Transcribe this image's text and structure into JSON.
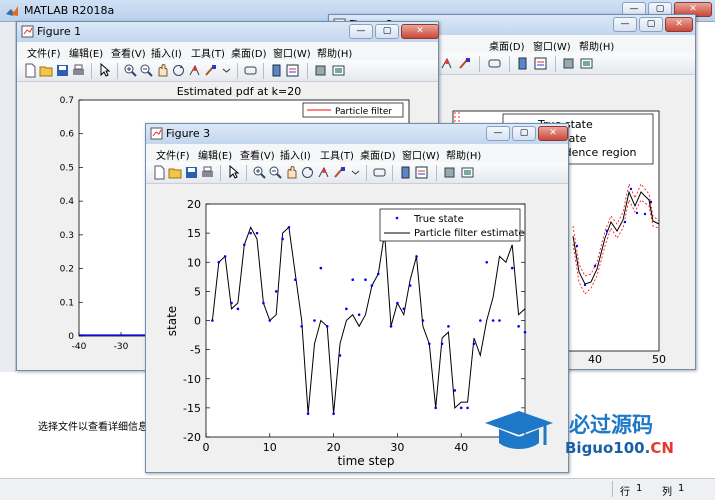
{
  "main_window": {
    "title": "MATLAB R2018a",
    "status_text": "选择文件以查看详细信息",
    "statusbar": {
      "row_label": "行",
      "row_value": "1",
      "col_label": "列",
      "col_value": "1"
    }
  },
  "menus": {
    "file": "文件(F)",
    "edit": "编辑(E)",
    "view": "查看(V)",
    "insert": "插入(I)",
    "tools": "工具(T)",
    "desktop": "桌面(D)",
    "window": "窗口(W)",
    "help": "帮助(H)"
  },
  "window_buttons": {
    "minimize": "—",
    "maximize": "▢",
    "close": "✕"
  },
  "figure1": {
    "title": "Figure 1",
    "chart_data": {
      "type": "line",
      "title": "Estimated pdf at k=20",
      "legend": [
        "Particle filter"
      ],
      "legend_placement": "top-right",
      "xlim": [
        -40,
        0
      ],
      "ylim": [
        0,
        0.7
      ],
      "x_ticks": [
        "-40",
        "-30"
      ],
      "y_ticks": [
        "0",
        "0.1",
        "0.2",
        "0.3",
        "0.4",
        "0.5",
        "0.6",
        "0.7"
      ],
      "series": [
        {
          "name": "Particle filter",
          "color": "#ff0000"
        }
      ],
      "baseline_color": "#0000ff"
    }
  },
  "figure2": {
    "title": "Figure 2",
    "chart_data": {
      "type": "line",
      "legend": [
        "True state",
        "estimate",
        "confidence region"
      ],
      "legend_placement": "top-right",
      "x_ticks": [
        "40",
        "50"
      ],
      "series": [
        {
          "name": "True state",
          "color": "#0000ff"
        },
        {
          "name": "estimate",
          "color": "#000000"
        },
        {
          "name": "confidence region",
          "color": "#ff0000"
        }
      ]
    }
  },
  "figure3": {
    "title": "Figure 3",
    "chart_data": {
      "type": "line",
      "xlabel": "time step",
      "ylabel": "state",
      "xlim": [
        0,
        50
      ],
      "ylim": [
        -20,
        20
      ],
      "x_ticks": [
        "0",
        "10",
        "20",
        "30",
        "40"
      ],
      "y_ticks": [
        "20",
        "15",
        "10",
        "5",
        "0",
        "-5",
        "-10",
        "-15",
        "-20"
      ],
      "legend_placement": "top-right",
      "series": [
        {
          "name": "True state",
          "style": "points",
          "color": "#0000ff",
          "x": [
            1,
            2,
            3,
            4,
            5,
            6,
            7,
            8,
            9,
            10,
            11,
            12,
            13,
            14,
            15,
            16,
            17,
            18,
            19,
            20,
            21,
            22,
            23,
            24,
            25,
            26,
            27,
            28,
            29,
            30,
            31,
            32,
            33,
            34,
            35,
            36,
            37,
            38,
            39,
            40,
            41,
            42,
            43,
            44,
            45,
            46,
            47,
            48,
            49,
            50
          ],
          "y": [
            0,
            10,
            11,
            3,
            2,
            13,
            15,
            15,
            3,
            0,
            5,
            14,
            16,
            7,
            -1,
            -16,
            0,
            9,
            -1,
            -16,
            -6,
            2,
            7,
            1,
            7,
            6,
            8,
            14,
            -1,
            3,
            2,
            6,
            11,
            0,
            -4,
            -15,
            -4,
            -1,
            -12,
            -15,
            -15,
            -4,
            0,
            10,
            0,
            0,
            14,
            9,
            -1,
            -2
          ]
        },
        {
          "name": "Particle filter estimate",
          "style": "line",
          "color": "#000000",
          "x": [
            1,
            2,
            3,
            4,
            5,
            6,
            7,
            8,
            9,
            10,
            11,
            12,
            13,
            14,
            15,
            16,
            17,
            18,
            19,
            20,
            21,
            22,
            23,
            24,
            25,
            26,
            27,
            28,
            29,
            30,
            31,
            32,
            33,
            34,
            35,
            36,
            37,
            38,
            39,
            40,
            41,
            42,
            43,
            44,
            45,
            46,
            47,
            48,
            49,
            50
          ],
          "y": [
            0,
            10,
            11,
            2,
            3,
            13,
            16,
            14,
            3,
            0,
            1,
            15,
            16,
            8,
            0,
            -16,
            -4,
            0,
            -1,
            -16,
            -4,
            0,
            1,
            -1,
            1,
            6,
            8,
            15,
            -1,
            3,
            1,
            7,
            11,
            -1,
            -4,
            -15,
            -3,
            -2,
            -15,
            -14,
            -14,
            -3,
            -6,
            0,
            4,
            11,
            10,
            13,
            1,
            2
          ]
        }
      ]
    }
  },
  "watermark": {
    "title": "必过源码",
    "url_main": "Biguo100.",
    "url_tld": "CN"
  }
}
